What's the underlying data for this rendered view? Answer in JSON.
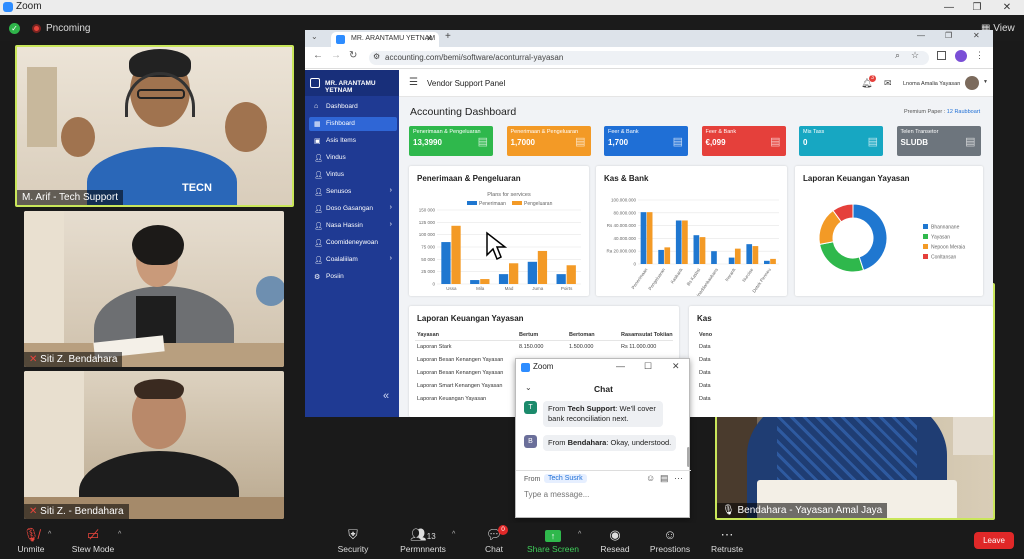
{
  "window": {
    "title": "Zoom",
    "view_label": "View"
  },
  "meeting": {
    "recording_label": "Pncoming"
  },
  "participants": [
    {
      "name": "M. Arif - Tech Support",
      "shirt_text": "TECN"
    },
    {
      "name": "Siti Z. Bendahara"
    },
    {
      "name": "Siti Z. - Bendahara"
    },
    {
      "name": "Bendahara - Yayasan Amal Jaya"
    }
  ],
  "browser": {
    "tab_title": "MR. ARANTAMU YETNAM",
    "url": "accounting.com/bemi/software/aconturral-yayasan"
  },
  "app": {
    "brand": "MR. ARANTAMU YETNAM",
    "panel_title": "Vendor Support Panel",
    "user_name": "Lnoma Amalia Yayasan",
    "notif_count": "3",
    "dashboard_title": "Accounting Dashboard",
    "premium_label": "Premium Paper :",
    "premium_value": "12 Raubboart",
    "sidebar": [
      {
        "label": "Dashboard",
        "icon": "home-icon"
      },
      {
        "label": "Fishboard",
        "icon": "grid-icon",
        "active": true
      },
      {
        "label": "Asis Items",
        "icon": "box-icon"
      },
      {
        "label": "Vindus",
        "icon": "user-icon"
      },
      {
        "label": "Vintus",
        "icon": "user-icon"
      },
      {
        "label": "Senusos",
        "icon": "user-icon",
        "arrow": true
      },
      {
        "label": "Doso Gasangan",
        "icon": "user-icon",
        "arrow": true
      },
      {
        "label": "Nasa Hassin",
        "icon": "user-icon",
        "arrow": true
      },
      {
        "label": "Coomideneywoan",
        "icon": "user-icon"
      },
      {
        "label": "Coalaliilam",
        "icon": "user-icon",
        "arrow": true
      },
      {
        "label": "Posiin",
        "icon": "settings-icon"
      }
    ],
    "kpis": [
      {
        "label": "Penerimaan & Pengeluaran",
        "value": "13,3990",
        "color": "#2fb84c"
      },
      {
        "label": "Penerimaan & Pengeluaran",
        "value": "1,7000",
        "color": "#f39a26"
      },
      {
        "label": "Feer & Bank",
        "value": "1,700",
        "color": "#1f6fd6"
      },
      {
        "label": "Feer & Bank",
        "value": "€,099",
        "color": "#e5403b"
      },
      {
        "label": "Mis Tass",
        "value": "0",
        "color": "#17a7c2"
      },
      {
        "label": "Telen Transetor",
        "value": "SLUDB",
        "color": "#6d757d"
      }
    ],
    "chart1_title": "Penerimaan & Pengeluaran",
    "chart2_title": "Kas & Bank",
    "chart3_title": "Laporan Keuangan Yayasan",
    "table_title": "Laporan Keuangan Yayasan",
    "table_title2": "Kas",
    "table": {
      "headers": [
        "Yayasan",
        "Bertum",
        "Bertoman",
        "Rasamsutat Tokiian"
      ],
      "rows": [
        [
          "Laporan Stark",
          "8.150.000",
          "1.500.000",
          "Rs 11.000.000"
        ],
        [
          "Laporan Besan Kenangen Yayasan",
          "",
          "",
          ""
        ],
        [
          "Laporan Besan Kenangen Yayasan",
          "",
          "",
          ""
        ],
        [
          "Laporan Smart Kenangen Yayasan",
          "",
          "",
          ""
        ],
        [
          "Laporan Keuangan Yayasan",
          "",
          "",
          ""
        ]
      ],
      "side_header": "Veno",
      "side_rows": [
        "Data",
        "Data",
        "Data",
        "Data",
        "Data"
      ]
    }
  },
  "chart_data": [
    {
      "type": "bar",
      "title": "Penerimaan & Pengeluaran",
      "subtitle": "Plans for services",
      "categories": [
        "Ussa",
        "Mila",
        "Mad",
        "Juma",
        "Poirts"
      ],
      "series": [
        {
          "name": "Penerimaan",
          "values": [
            85000,
            8000,
            20000,
            45000,
            20000
          ],
          "color": "#1f77d0"
        },
        {
          "name": "Pengeluaran",
          "values": [
            118000,
            10000,
            42000,
            67000,
            38000
          ],
          "color": "#f39a26"
        }
      ],
      "ylim": [
        0,
        150000
      ],
      "yticks": [
        "0",
        "25 000",
        "50 000",
        "75 000",
        "100 000",
        "125 000",
        "150 000"
      ],
      "legend": "top"
    },
    {
      "type": "bar",
      "title": "Kas & Bank",
      "categories": [
        "Penerimaan",
        "Pengeluaran",
        "Kasbank",
        "Bs Kasbsi",
        "Inaddanbaobans",
        "Insrank",
        "Nuroise",
        "Detek Penneu"
      ],
      "series": [
        {
          "name": "Kas",
          "values": [
            81000000,
            22000000,
            68000000,
            45000000,
            20000000,
            10000000,
            31000000,
            5000000
          ],
          "color": "#1f77d0"
        },
        {
          "name": "Bank",
          "values": [
            81000000,
            26000000,
            68000000,
            42000000,
            0,
            24000000,
            28000000,
            8000000
          ],
          "color": "#f39a26"
        }
      ],
      "ylim": [
        0,
        100000000
      ],
      "yticks": [
        "0",
        "Ra 20.000.000",
        "40.000.000",
        "Rs 40.000.000",
        "80.000.000",
        "100.000.000"
      ]
    },
    {
      "type": "pie",
      "title": "Laporan Keuangan Yayasan",
      "slices": [
        {
          "label": "Bhannanane",
          "value": 45,
          "color": "#1f77d0"
        },
        {
          "label": "Yayasan",
          "value": 27,
          "color": "#2fb84c"
        },
        {
          "label": "Nepoon Meraia",
          "value": 18,
          "color": "#f39a26"
        },
        {
          "label": "Conltansan",
          "value": 10,
          "color": "#e5403b"
        }
      ],
      "legend": "right"
    }
  ],
  "chat": {
    "window_title": "Zoom",
    "title": "Chat",
    "messages": [
      {
        "avatar": "T",
        "from_prefix": "From ",
        "from": "Tech Support",
        "text": ": We'll cover bank reconciliation next.",
        "color": "#1b8a6b"
      },
      {
        "avatar": "B",
        "from_prefix": "From ",
        "from": "Bendahara",
        "text": ": Okay, understood.",
        "color": "#6b6f9a"
      }
    ],
    "to_label": "From",
    "to_value": "Tech Susrk",
    "placeholder": "Type a message..."
  },
  "toolbar": {
    "unmute": "Unmite",
    "stop_video": "Stew Mode",
    "security": "Security",
    "participants": "Permnnents",
    "participant_count": "13",
    "chat": "Chat",
    "chat_badge": "0",
    "share": "Share Screen",
    "record": "Resead",
    "reactions": "Preostions",
    "more": "Retruste",
    "leave": "Leave"
  }
}
